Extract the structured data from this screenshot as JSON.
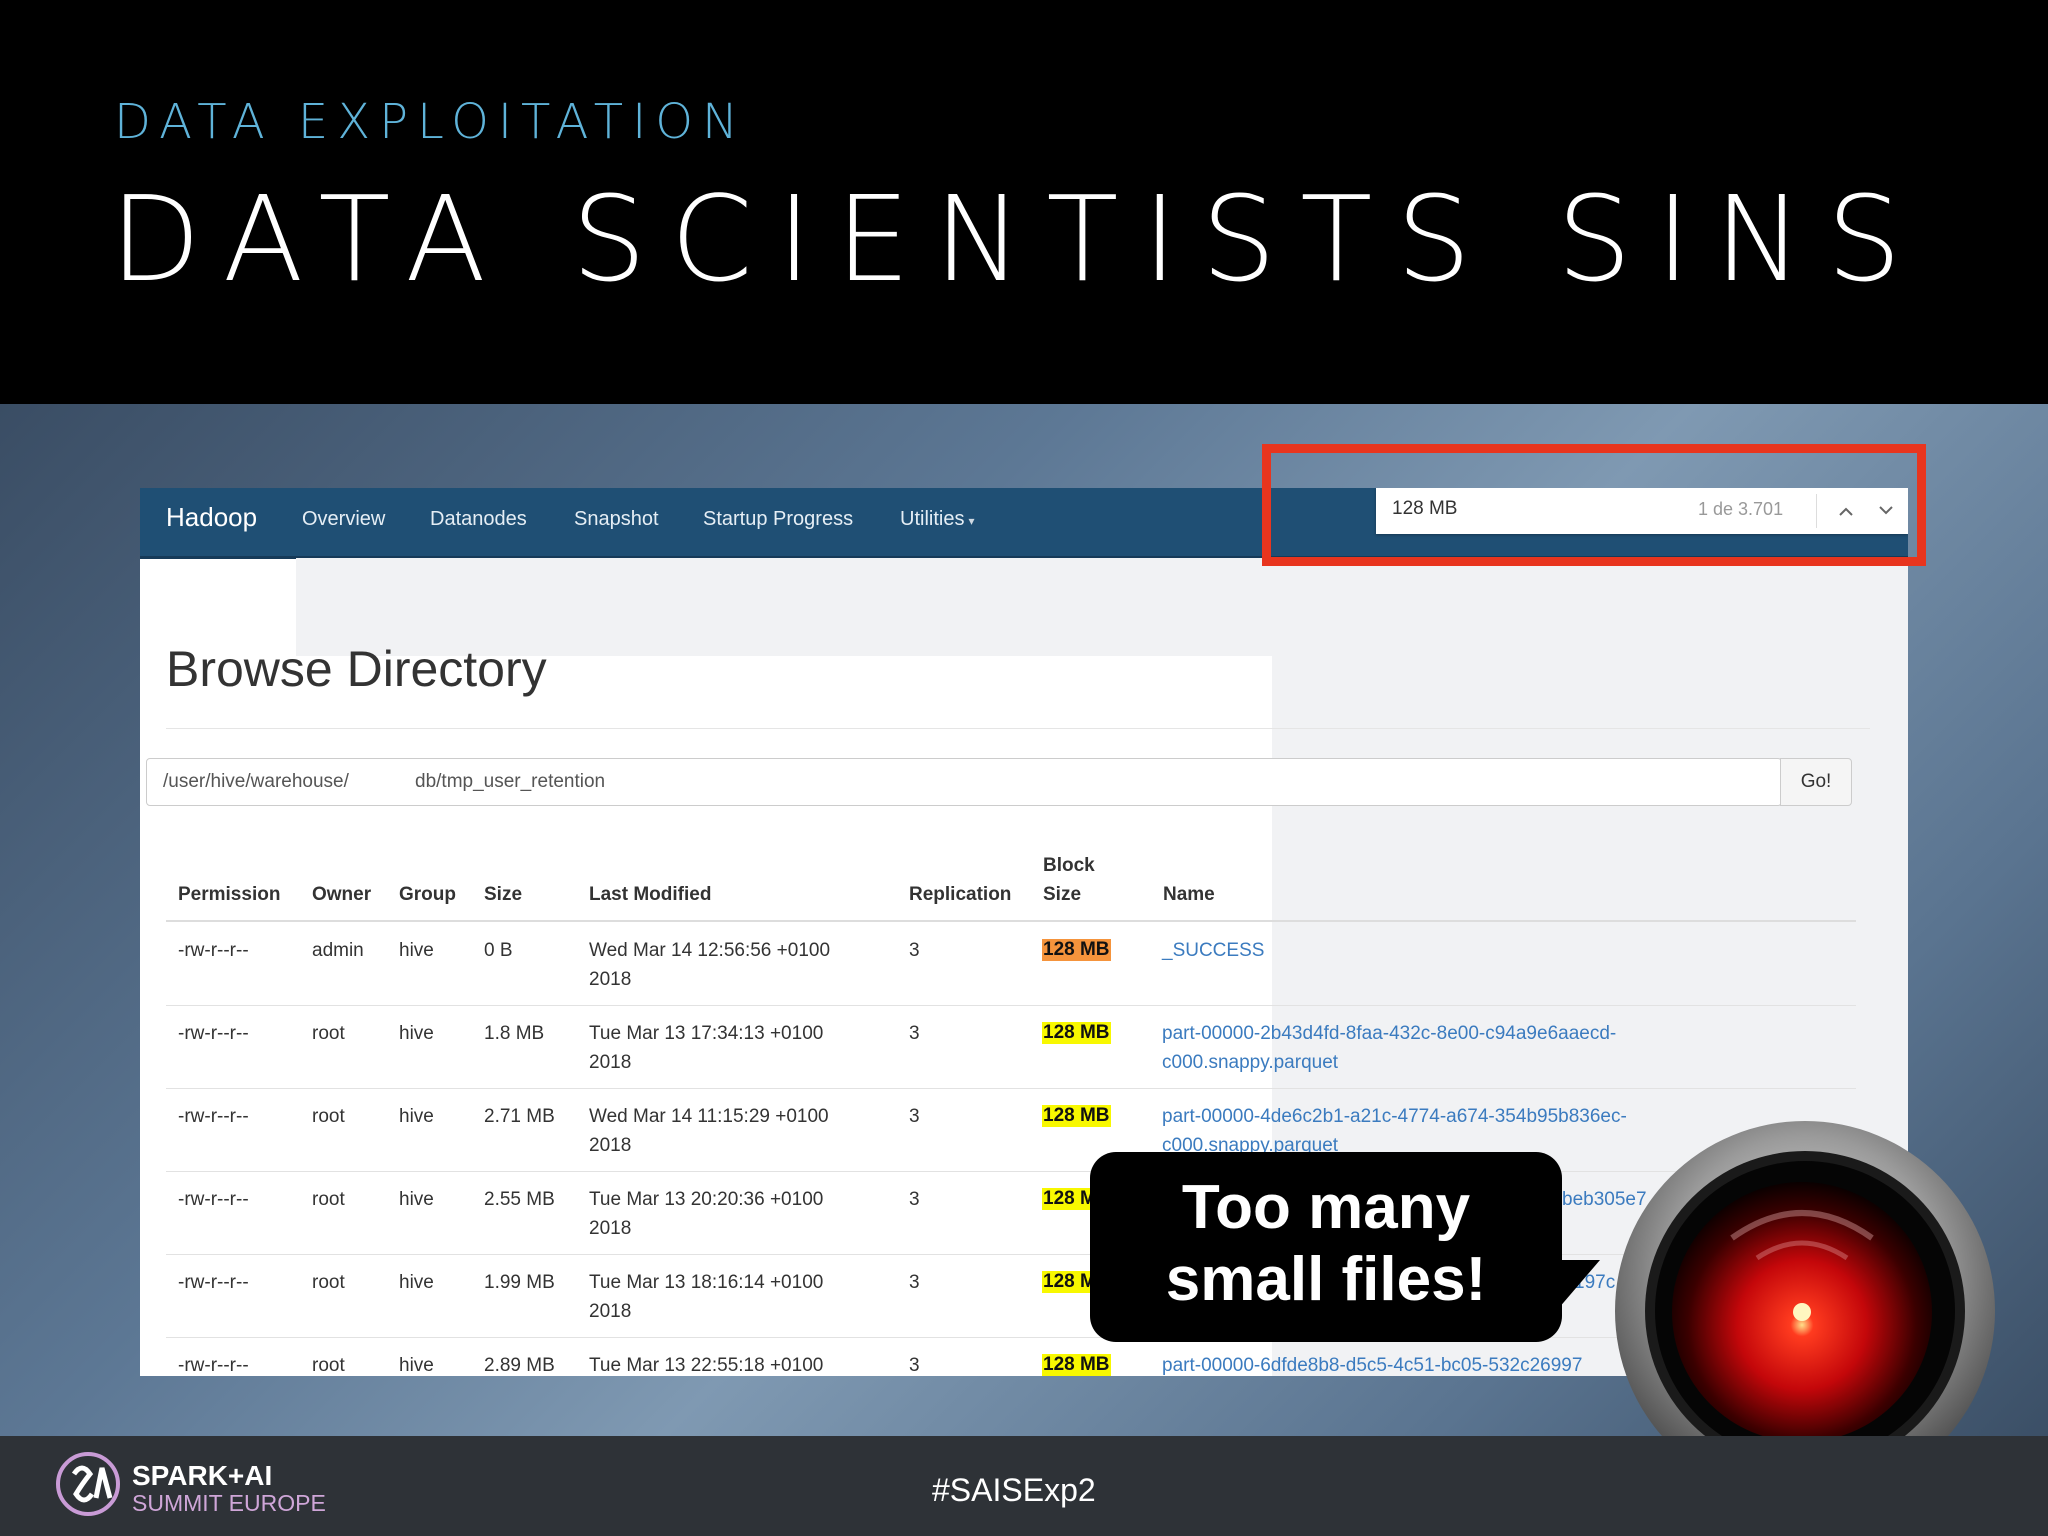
{
  "slide": {
    "subtitle": "DATA EXPLOITATION",
    "title": "DATA SCIENTISTS SINS",
    "callout": [
      "Too many",
      "small files!"
    ],
    "hashtag": "#SAISExp2",
    "logo": {
      "line1": "SPARK+AI",
      "line2": "SUMMIT EUROPE"
    }
  },
  "navbar": {
    "brand": "Hadoop",
    "links": [
      "Overview",
      "Datanodes",
      "Snapshot",
      "Startup Progress",
      "Utilities"
    ],
    "utilities_caret": "▾"
  },
  "findbar": {
    "query": "128 MB",
    "count": "1 de 3.701",
    "prev_icon": "chevron-up-icon",
    "next_icon": "chevron-down-icon"
  },
  "page": {
    "title": "Browse Directory",
    "path_part1": "/user/hive/warehouse/",
    "path_part2": "db/tmp_user_retention",
    "go_label": "Go!"
  },
  "table": {
    "headers": {
      "permission": "Permission",
      "owner": "Owner",
      "group": "Group",
      "size": "Size",
      "last_modified": "Last Modified",
      "replication": "Replication",
      "block_size_1": "Block",
      "block_size_2": "Size",
      "name": "Name"
    },
    "rows": [
      {
        "permission": "-rw-r--r--",
        "owner": "admin",
        "group": "hive",
        "size": "0 B",
        "modified_1": "Wed Mar 14 12:56:56 +0100",
        "modified_2": "2018",
        "replication": "3",
        "block_size": "128 MB",
        "name_1": "_SUCCESS",
        "name_2": ""
      },
      {
        "permission": "-rw-r--r--",
        "owner": "root",
        "group": "hive",
        "size": "1.8 MB",
        "modified_1": "Tue Mar 13 17:34:13 +0100",
        "modified_2": "2018",
        "replication": "3",
        "block_size": "128 MB",
        "name_1": "part-00000-2b43d4fd-8faa-432c-8e00-c94a9e6aaecd-",
        "name_2": "c000.snappy.parquet"
      },
      {
        "permission": "-rw-r--r--",
        "owner": "root",
        "group": "hive",
        "size": "2.71 MB",
        "modified_1": "Wed Mar 14 11:15:29 +0100",
        "modified_2": "2018",
        "replication": "3",
        "block_size": "128 MB",
        "name_1": "part-00000-4de6c2b1-a21c-4774-a674-354b95b836ec-",
        "name_2": "c000.snappy.parquet"
      },
      {
        "permission": "-rw-r--r--",
        "owner": "root",
        "group": "hive",
        "size": "2.55 MB",
        "modified_1": "Tue Mar 13 20:20:36 +0100",
        "modified_2": "2018",
        "replication": "3",
        "block_size": "128 MB",
        "name_1": "beb305e7",
        "name_2": ""
      },
      {
        "permission": "-rw-r--r--",
        "owner": "root",
        "group": "hive",
        "size": "1.99 MB",
        "modified_1": "Tue Mar 13 18:16:14 +0100",
        "modified_2": "2018",
        "replication": "3",
        "block_size": "128 MB",
        "name_1": "197c",
        "name_2": ""
      },
      {
        "permission": "-rw-r--r--",
        "owner": "root",
        "group": "hive",
        "size": "2.89 MB",
        "modified_1": "Tue Mar 13 22:55:18 +0100",
        "modified_2": "",
        "replication": "3",
        "block_size": "128 MB",
        "name_1": "part-00000-6dfde8b8-d5c5-4c51-bc05-532c26997",
        "name_2": ""
      }
    ]
  },
  "colors": {
    "navbar": "#1f4f74",
    "highlight_current": "#f5943c",
    "highlight_match": "#f8f800",
    "annotation_box": "#e8351e",
    "link": "#3b7bbf",
    "subtitle": "#5fb3d9"
  }
}
